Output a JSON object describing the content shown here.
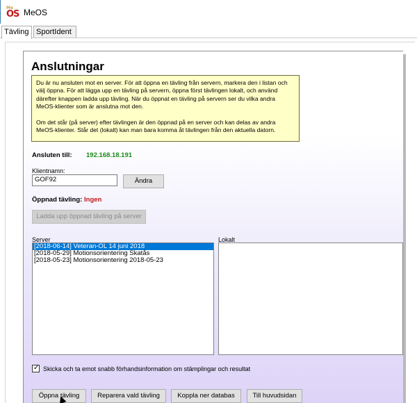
{
  "window": {
    "title": "MeOS",
    "icon": "meos-app-icon"
  },
  "tabs": [
    {
      "label": "Tävling",
      "active": true
    },
    {
      "label": "SportIdent",
      "active": false
    }
  ],
  "panel": {
    "heading": "Anslutningar",
    "info_para1": "Du är nu ansluten mot en server. För att öppna en tävling från servern, markera den i listan och välj öppna. För att lägga upp en tävling på servern, öppna först tävlingen lokalt, och använd därefter knappen ladda upp tävling. När du öppnat en tävling på servern ser du vilka andra MeOS-klienter som är anslutna mot den.",
    "info_para2": "Om det står (på server) efter tävlingen är den öppnad på en server och kan delas av andra MeOS-klienter. Står det (lokalt) kan man bara komma åt tävlingen från den aktuella datorn.",
    "connected_label": "Ansluten till:",
    "connected_value": "192.168.18.191",
    "client_name_label": "Klientnamn:",
    "client_name_value": "GOF92",
    "change_button": "Ändra",
    "opened_label": "Öppnad tävling:",
    "opened_value": "Ingen",
    "upload_button": "Ladda upp öppnad tävling på server",
    "server_label": "Server",
    "local_label": "Lokalt",
    "server_items": [
      "[2018-06-14] Veteran-OL 14 juni 2018",
      "[2018-05-29] Motionsorientering Skatås",
      "[2018-05-23] Motionsorientering 2018-05-23"
    ],
    "selected_index": 0,
    "local_items": [],
    "checkbox_label": "Skicka och ta emot snabb förhandsinformation om stämplingar och resultat",
    "checkbox_checked": true,
    "buttons": {
      "open": "Öppna tävling",
      "repair": "Reparera vald tävling",
      "disconnect": "Koppla ner databas",
      "main": "Till huvudsidan"
    }
  },
  "colors": {
    "selection": "#0078d7",
    "connected": "#1a8a1a",
    "none": "#c01818",
    "info_bg": "#ffffc8"
  }
}
